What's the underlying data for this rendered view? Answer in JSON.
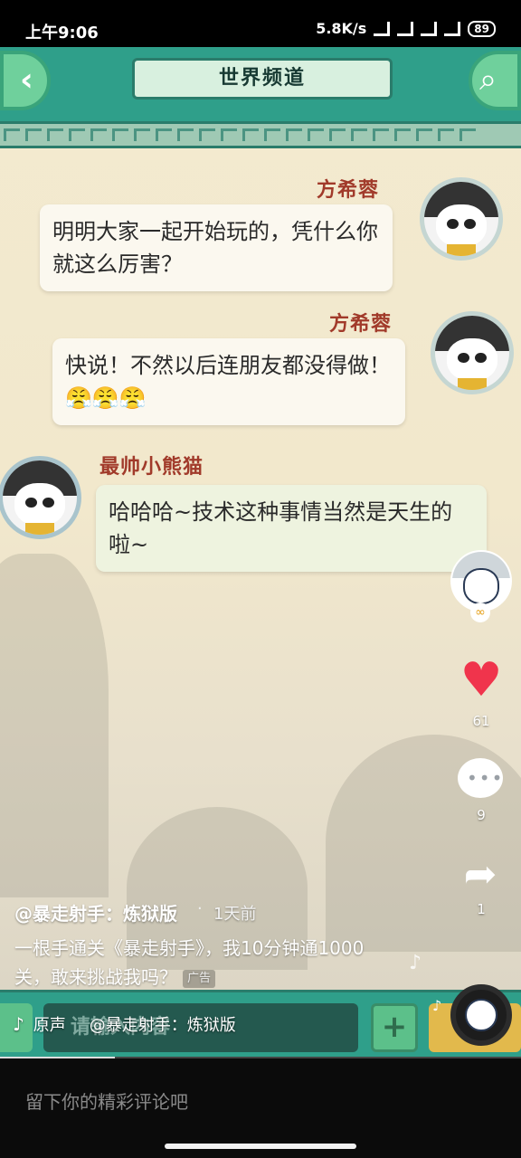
{
  "status_bar": {
    "time": "上午9:06",
    "network_speed": "5.8K/s",
    "battery": "89"
  },
  "game": {
    "title": "世界频道",
    "input_placeholder": "请输入内容",
    "plus_label": "+",
    "messages": [
      {
        "sender": "方希蓉",
        "text": "明明大家一起开始玩的，凭什么你就这么厉害？",
        "side": "right"
      },
      {
        "sender": "方希蓉",
        "text": "快说！不然以后连朋友都没得做！😤😤😤",
        "side": "right"
      },
      {
        "sender": "最帅小熊猫",
        "text": "哈哈哈~技术这种事情当然是天生的啦~",
        "side": "left"
      }
    ]
  },
  "rail": {
    "likes": "61",
    "comments": "9",
    "shares": "1"
  },
  "post": {
    "author": "@暴走射手：炼狱版",
    "time_ago": "1天前",
    "description": "一根手通关《暴走射手》，我10分钟通1000关，敢来挑战我吗？",
    "ad_tag": "广告"
  },
  "music": {
    "label": "原声",
    "artist": "@暴走射手：炼狱版"
  },
  "comment_bar": {
    "placeholder": "留下你的精彩评论吧"
  },
  "progress": {
    "fraction": 0.22
  }
}
